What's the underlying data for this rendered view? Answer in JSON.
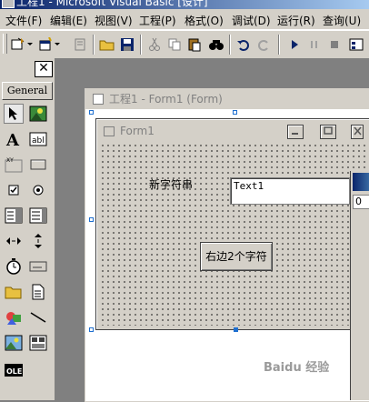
{
  "window": {
    "title": "工程1 - Microsoft Visual Basic [设计]"
  },
  "menu": [
    "文件(F)",
    "编辑(E)",
    "视图(V)",
    "工程(P)",
    "格式(O)",
    "调试(D)",
    "运行(R)",
    "查询(U)"
  ],
  "toolbox": {
    "tab_label": "General",
    "close_label": "✕"
  },
  "outer_form": {
    "title": "工程1 - Form1 (Form)"
  },
  "form1": {
    "title": "Form1",
    "label_text": "新字符串",
    "textbox_value": "Text1",
    "button_label": "右边2个字符"
  },
  "right_panel": {
    "field_text": "0"
  },
  "watermark": {
    "text": "Baidu 经验"
  },
  "icons": {
    "selection_accent": "#1e6fd0",
    "title_gradient_start": "#0a246a"
  }
}
